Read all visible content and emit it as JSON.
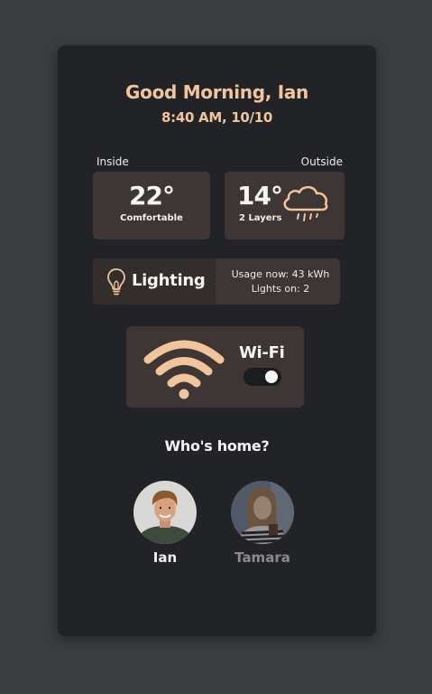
{
  "header": {
    "greeting": "Good Morning, Ian",
    "datetime": "8:40 AM, 10/10"
  },
  "climate": {
    "inside_label": "Inside",
    "outside_label": "Outside",
    "inside_temp": "22°",
    "inside_status": "Comfortable",
    "outside_temp": "14°",
    "outside_status": "2 Layers",
    "outside_icon": "cloud-rain-icon"
  },
  "lighting": {
    "label": "Lighting",
    "icon": "lightbulb-icon",
    "usage": "Usage now: 43 kWh",
    "lights_on": "Lights on: 2"
  },
  "wifi": {
    "label": "Wi-Fi",
    "icon": "wifi-icon",
    "enabled": true
  },
  "household": {
    "title": "Who's home?",
    "members": [
      {
        "name": "Ian",
        "home": true
      },
      {
        "name": "Tamara",
        "home": false
      }
    ]
  },
  "colors": {
    "background": "#3a3c40",
    "panel": "#222327",
    "card": "#3d3634",
    "accent": "#f2c49b",
    "text": "#f4f4f4",
    "muted": "#8b8b8d"
  }
}
